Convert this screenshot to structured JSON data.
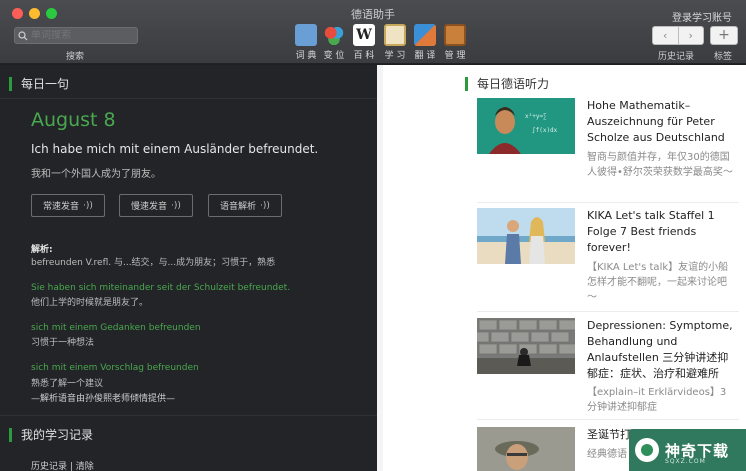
{
  "window": {
    "title": "德语助手",
    "account": "登录学习账号"
  },
  "search": {
    "placeholder": "单词搜索",
    "label": "搜索"
  },
  "toolbar": {
    "items": [
      {
        "label": "词 典",
        "icon": "dictionary-icon",
        "color": "#6a9fd6"
      },
      {
        "label": "变 位",
        "icon": "conjugation-icon",
        "color": "#3aa0d8"
      },
      {
        "label": "百 科",
        "icon": "wiki-icon",
        "color": "#ffffff"
      },
      {
        "label": "学 习",
        "icon": "study-icon",
        "color": "#e0c07a"
      },
      {
        "label": "翻 译",
        "icon": "translate-icon",
        "color": "#e07a3a"
      },
      {
        "label": "管 理",
        "icon": "manage-icon",
        "color": "#c9803a"
      }
    ],
    "back": "‹",
    "forward": "›",
    "add": "+",
    "history_label": "历史记录",
    "bookmark_label": "标签"
  },
  "daily": {
    "heading": "每日一句",
    "date": "August 8",
    "sentence_de": "Ich habe mich mit einem Ausländer befreundet.",
    "sentence_zh": "我和一个外国人成为了朋友。",
    "buttons": [
      "常速发音",
      "慢速发音",
      "语音解析"
    ],
    "explain_title": "解析:",
    "explain_text": "befreunden V.refl. 与...结交，与...成为朋友；习惯于，熟悉",
    "examples": [
      {
        "de": "Sie haben sich miteinander seit der Schulzeit befreundet.",
        "zh": "他们上学的时候就是朋友了。"
      },
      {
        "de": "sich mit einem Gedanken befreunden",
        "zh": "习惯于一种想法"
      },
      {
        "de": "sich mit einem Vorschlag befreunden",
        "zh": "熟悉了解一个建议"
      }
    ],
    "credit": "—解析语音由孙俊熙老师倾情提供—"
  },
  "history": {
    "heading": "我的学习记录",
    "links": "历史记录 | 清除"
  },
  "listening": {
    "heading": "每日德语听力",
    "articles": [
      {
        "title": "Hohe Mathematik–Auszeichnung für Peter Scholze aus Deutschland",
        "subtitle": "智商与颜值并存，年仅30的德国人彼得•舒尔茨荣获数学最高奖～"
      },
      {
        "title": "KIKA Let's talk Staffel 1 Folge 7 Best friends forever!",
        "subtitle": "【KIKA Let's talk】友谊的小船怎样才能不翻呢，一起来讨论吧～"
      },
      {
        "title": "Depressionen: Symptome, Behandlung und Anlaufstellen 三分钟讲述抑郁症：症状、治疗和避难所",
        "subtitle": "【explain–it Erklärvideos】3分钟讲述抑郁症"
      },
      {
        "title": "圣诞节打",
        "subtitle": "经典德语"
      }
    ]
  },
  "watermark": {
    "text": "神奇下载",
    "url": "SQXZ.COM"
  }
}
